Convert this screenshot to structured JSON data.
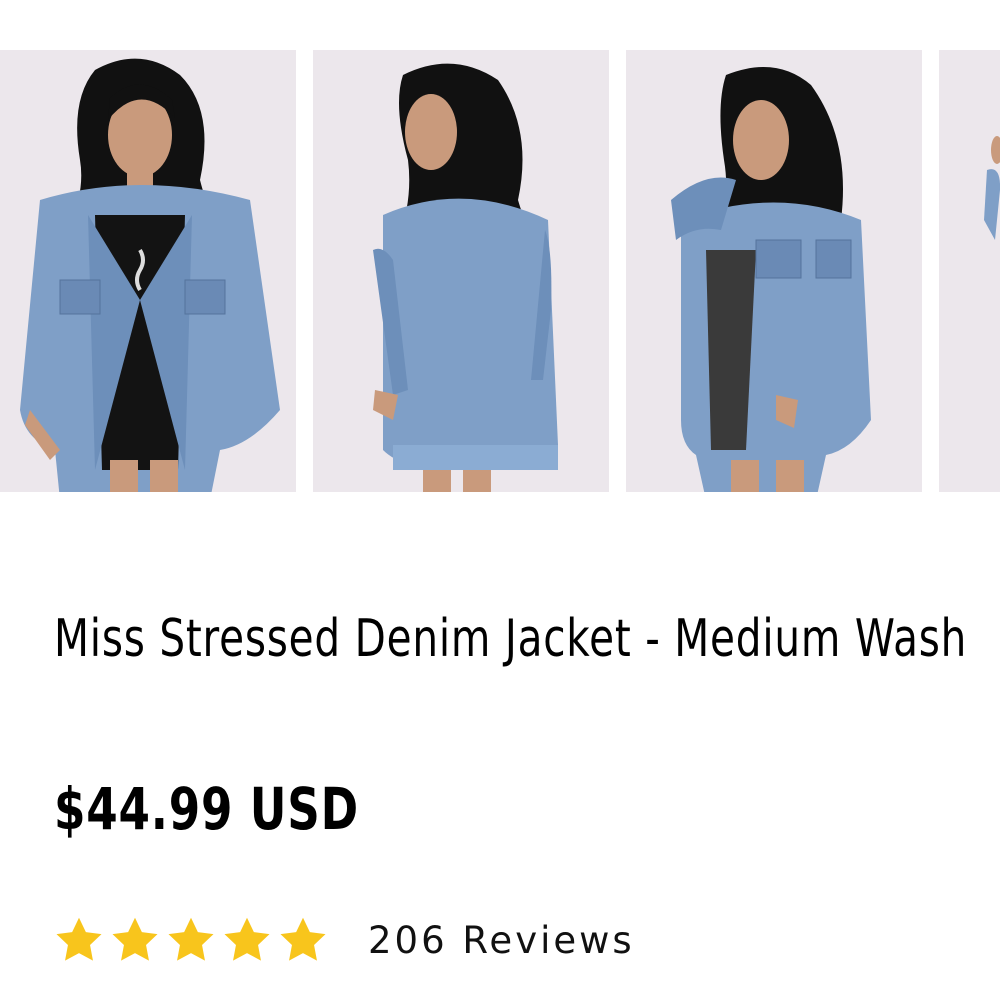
{
  "product": {
    "title": "Miss Stressed Denim Jacket - Medium Wash",
    "price": "$44.99 USD",
    "rating": {
      "stars": 5,
      "max_stars": 5,
      "star_color": "#f8c51c",
      "reviews_label": "206 Reviews"
    }
  },
  "colors": {
    "background": "#ffffff",
    "photo_backdrop": "#ece7ec",
    "denim": "#7f9fc7"
  }
}
